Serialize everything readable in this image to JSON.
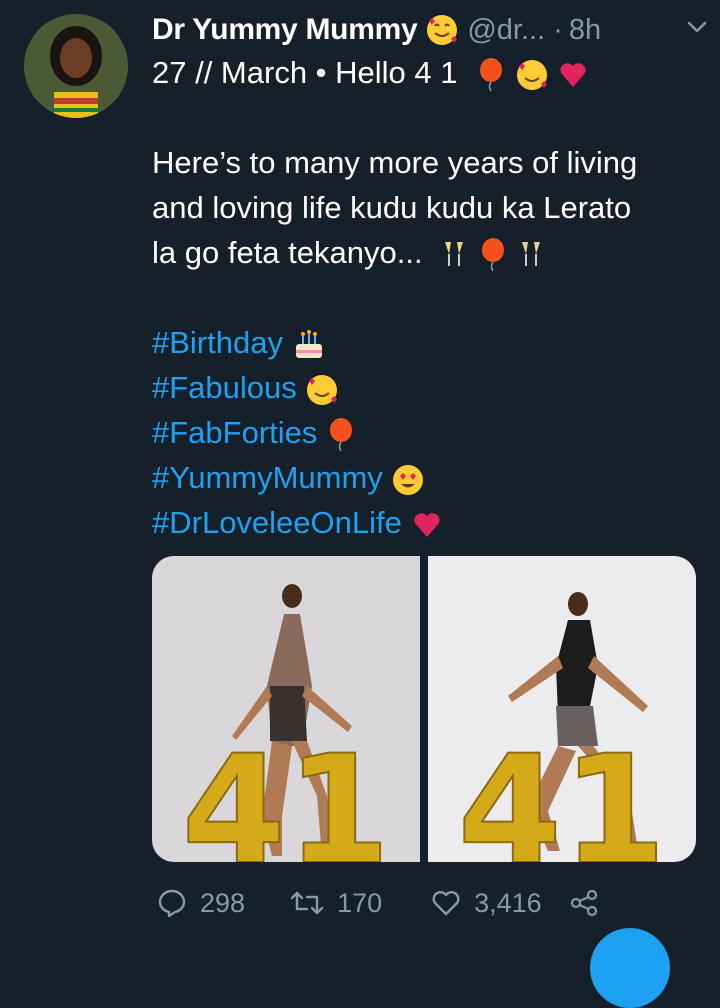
{
  "tweet": {
    "display_name": "Dr Yummy Mummy",
    "handle": "@dr...",
    "separator": "·",
    "time": "8h",
    "lines": [
      "27 // March • Hello 4 1",
      "Here’s to many more years of living",
      "and loving life kudu kudu ka Lerato",
      "la go feta tekanyo..."
    ],
    "hashtags": [
      "#Birthday",
      "#Fabulous",
      "#FabForties",
      "#YummyMummy",
      "#DrLoveleeOnLife"
    ]
  },
  "media": {
    "photo_left_numbers": "41",
    "photo_right_numbers": "41"
  },
  "actions": {
    "replies": "298",
    "retweets": "170",
    "likes": "3,416"
  },
  "colors": {
    "background": "#15202b",
    "secondary_text": "#8899a6",
    "link": "#1da1f2"
  }
}
